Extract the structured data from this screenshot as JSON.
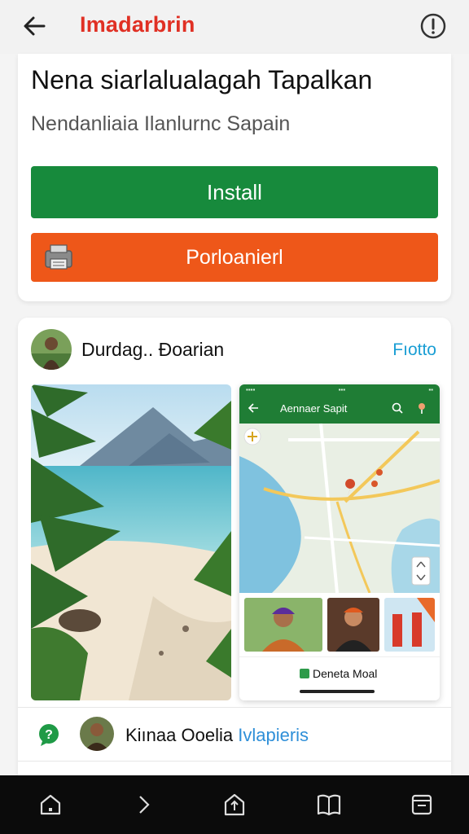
{
  "topbar": {
    "title": "Imadarbrin",
    "back_icon": "arrow-left-icon",
    "info_icon": "info-circle-icon"
  },
  "header_card": {
    "headline": "Nena siarlalualagah Tapalkan",
    "subhead": "Nendanliaia Ilanlurnc Sapain",
    "install_label": "Install",
    "secondary_label": "Porloanierl",
    "install_color": "#178a3c",
    "secondary_color": "#ee5719",
    "secondary_icon": "printer-icon"
  },
  "post": {
    "author": "Durdag.. Ðoarian",
    "follow_label": "Fıotto",
    "phone": {
      "title": "Aennaer Sapit",
      "footer_label": "Deneta Moal"
    }
  },
  "comment": {
    "name": "Kiınaa Ooelia",
    "highlight": "Ivlapieris"
  },
  "navbar": {
    "items": [
      "home-icon",
      "chevron-right-icon",
      "share-icon",
      "book-icon",
      "window-icon"
    ]
  },
  "colors": {
    "accent_red": "#e03024",
    "link_blue": "#1a9ed4",
    "nav_bg": "#0b0b0b"
  }
}
